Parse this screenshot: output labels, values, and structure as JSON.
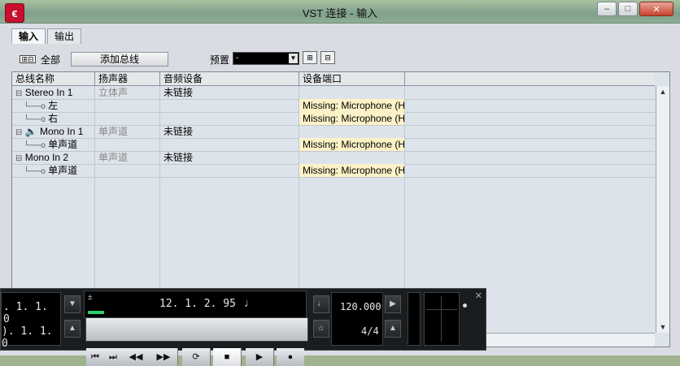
{
  "window": {
    "title": "VST 连接 - 输入",
    "app_icon": "cubase-logo-icon",
    "min": "–",
    "max": "□",
    "close": "✕"
  },
  "tabs": [
    {
      "label": "输入"
    },
    {
      "label": "输出"
    }
  ],
  "toolbar": {
    "expand_toggle": "⊞⊟",
    "expand_all": "全部",
    "add_bus": "添加总线",
    "preset_label": "预置",
    "preset_value": "-",
    "store_icon": "⊞",
    "delete_icon": "⊟"
  },
  "table": {
    "headers": [
      "总线名称",
      "扬声器",
      "音频设备",
      "设备端口"
    ],
    "rows": [
      {
        "name": "Stereo In 1",
        "speaker": "立体声",
        "device": "未链接",
        "port": ""
      },
      {
        "name": "左",
        "speaker": "",
        "device": "",
        "port": "Missing: Microphone (Hi"
      },
      {
        "name": "右",
        "speaker": "",
        "device": "",
        "port": "Missing: Microphone (Hi"
      },
      {
        "name": "Mono In 1",
        "speaker": "单声道",
        "device": "未链接",
        "port": ""
      },
      {
        "name": "单声道",
        "speaker": "",
        "device": "",
        "port": "Missing: Microphone (Hi"
      },
      {
        "name": "Mono In 2",
        "speaker": "单声道",
        "device": "未链接",
        "port": ""
      },
      {
        "name": "单声道",
        "speaker": "",
        "device": "",
        "port": "Missing: Microphone (Hi"
      }
    ]
  },
  "transport": {
    "pos1": ". 1. 1.   0",
    "pos2": "). 1. 1.   0",
    "main_pos": "12.  1.  2. 95",
    "tempo": "120.000",
    "signature": "4/4",
    "close": "✕"
  }
}
